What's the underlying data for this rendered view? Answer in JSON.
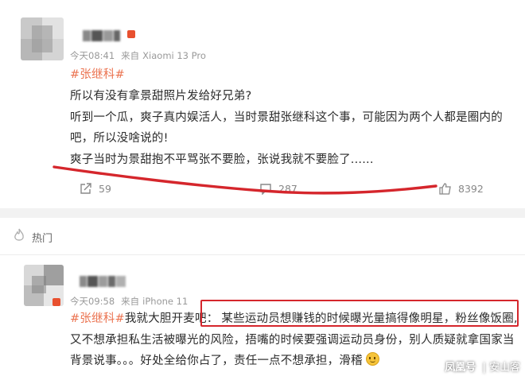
{
  "post1": {
    "meta": {
      "time": "今天08:41",
      "source_prefix": "来自",
      "device": "Xiaomi 13 Pro"
    },
    "hashtag": "#张继科#",
    "lines": [
      "所以有没有拿景甜照片发给好兄弟?",
      "听到一个瓜，爽子真内娱活人，当时景甜张继科这个事，可能因为两个人都是圈内的",
      "吧，所以没啥说的!",
      "爽子当时为景甜抱不平骂张不要脸，张说我就不要脸了......"
    ],
    "actions": {
      "share": "59",
      "comment": "287",
      "like": "8392"
    }
  },
  "hot_section": {
    "label": "热门"
  },
  "post2": {
    "meta": {
      "time": "今天09:58",
      "source_prefix": "来自",
      "device": "iPhone 11"
    },
    "hashtag": "#张继科#",
    "line1_intro": "我就大胆开麦吧：",
    "line1_highlight": "某些运动员想赚钱的时候曝光量搞得像明星，粉丝像饭圈,",
    "line2": "又不想承担私生活被曝光的风险，捂嘴的时候要强调运动员身份，别人质疑就拿国家当",
    "line3": "背景说事。。。好处全给你占了，责任一点不想承担，滑稽"
  },
  "watermark": {
    "logo": "凤凰号",
    "separator": "|",
    "author": "安山客"
  },
  "colors": {
    "hashtag": "#eb7350",
    "annotation_red": "#d5262c",
    "meta_gray": "#999999"
  }
}
